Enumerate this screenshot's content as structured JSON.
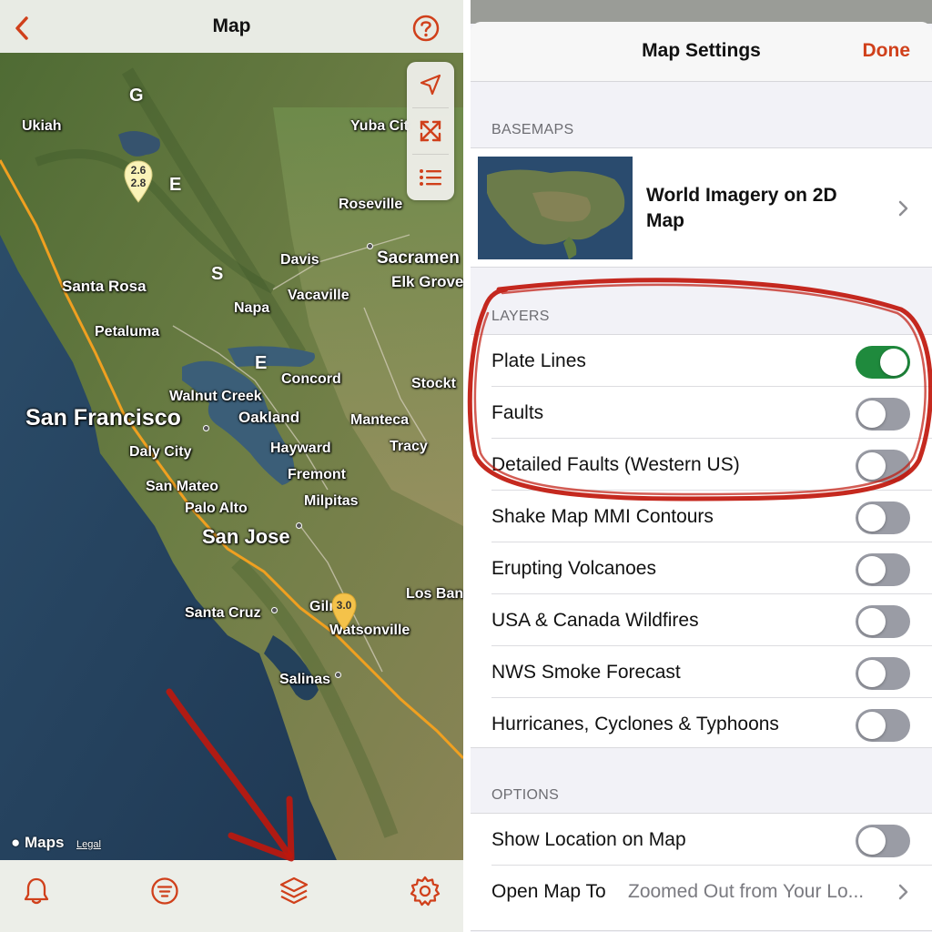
{
  "map_screen": {
    "title": "Map",
    "back_icon": "chevron-left-icon",
    "help_icon": "question-circle-icon",
    "controls": [
      "location-arrow-icon",
      "expand-arrows-icon",
      "list-icon"
    ],
    "cities": {
      "ukiah": "Ukiah",
      "yuba_city": "Yuba Cit",
      "roseville": "Roseville",
      "davis": "Davis",
      "sacramento": "Sacramen",
      "elk_grove": "Elk Grove",
      "santa_rosa": "Santa Rosa",
      "vacaville": "Vacaville",
      "napa": "Napa",
      "petaluma": "Petaluma",
      "concord": "Concord",
      "stockton": "Stockt",
      "walnut_creek": "Walnut Creek",
      "san_francisco": "San Francisco",
      "oakland": "Oakland",
      "manteca": "Manteca",
      "daly_city": "Daly City",
      "hayward": "Hayward",
      "tracy": "Tracy",
      "fremont": "Fremont",
      "san_mateo": "San Mateo",
      "palo_alto": "Palo Alto",
      "milpitas": "Milpitas",
      "san_jose": "San Jose",
      "los_banos": "Los Ban",
      "santa_cruz": "Santa Cruz",
      "gilroy": "Gilr",
      "watsonville": "Watsonville",
      "salinas": "Salinas"
    },
    "region_letters": [
      "G",
      "E",
      "S",
      "E"
    ],
    "quake_pins": [
      {
        "labels": [
          "2.6",
          "2.8"
        ]
      },
      {
        "labels": [
          "3.0"
        ]
      }
    ],
    "attribution": {
      "brand": "Maps",
      "legal": "Legal"
    },
    "tabs": [
      "bell-icon",
      "filter-list-icon",
      "layers-icon",
      "gear-icon"
    ],
    "colors": {
      "accent": "#d0401b",
      "plate_line": "#f0a020",
      "ocean": "#23405a",
      "land": "#5e7a3c"
    }
  },
  "settings": {
    "title": "Map Settings",
    "done_label": "Done",
    "basemaps": {
      "header": "BASEMAPS",
      "selected": "World Imagery on 2D Map"
    },
    "layers": {
      "header": "LAYERS",
      "items": [
        {
          "label": "Plate Lines",
          "on": true
        },
        {
          "label": "Faults",
          "on": false
        },
        {
          "label": "Detailed Faults (Western US)",
          "on": false
        },
        {
          "label": "Shake Map MMI Contours",
          "on": false
        },
        {
          "label": "Erupting Volcanoes",
          "on": false
        },
        {
          "label": "USA & Canada Wildfires",
          "on": false
        },
        {
          "label": "NWS Smoke Forecast",
          "on": false
        },
        {
          "label": "Hurricanes, Cyclones & Typhoons",
          "on": false
        }
      ]
    },
    "options": {
      "header": "OPTIONS",
      "show_location_label": "Show Location on Map",
      "show_location_on": false,
      "open_map_label": "Open Map To",
      "open_map_value": "Zoomed Out from Your Lo..."
    },
    "colors": {
      "toggle_on": "#1f8a3d",
      "toggle_off": "#9a9ca5",
      "accent": "#d0401b"
    }
  }
}
